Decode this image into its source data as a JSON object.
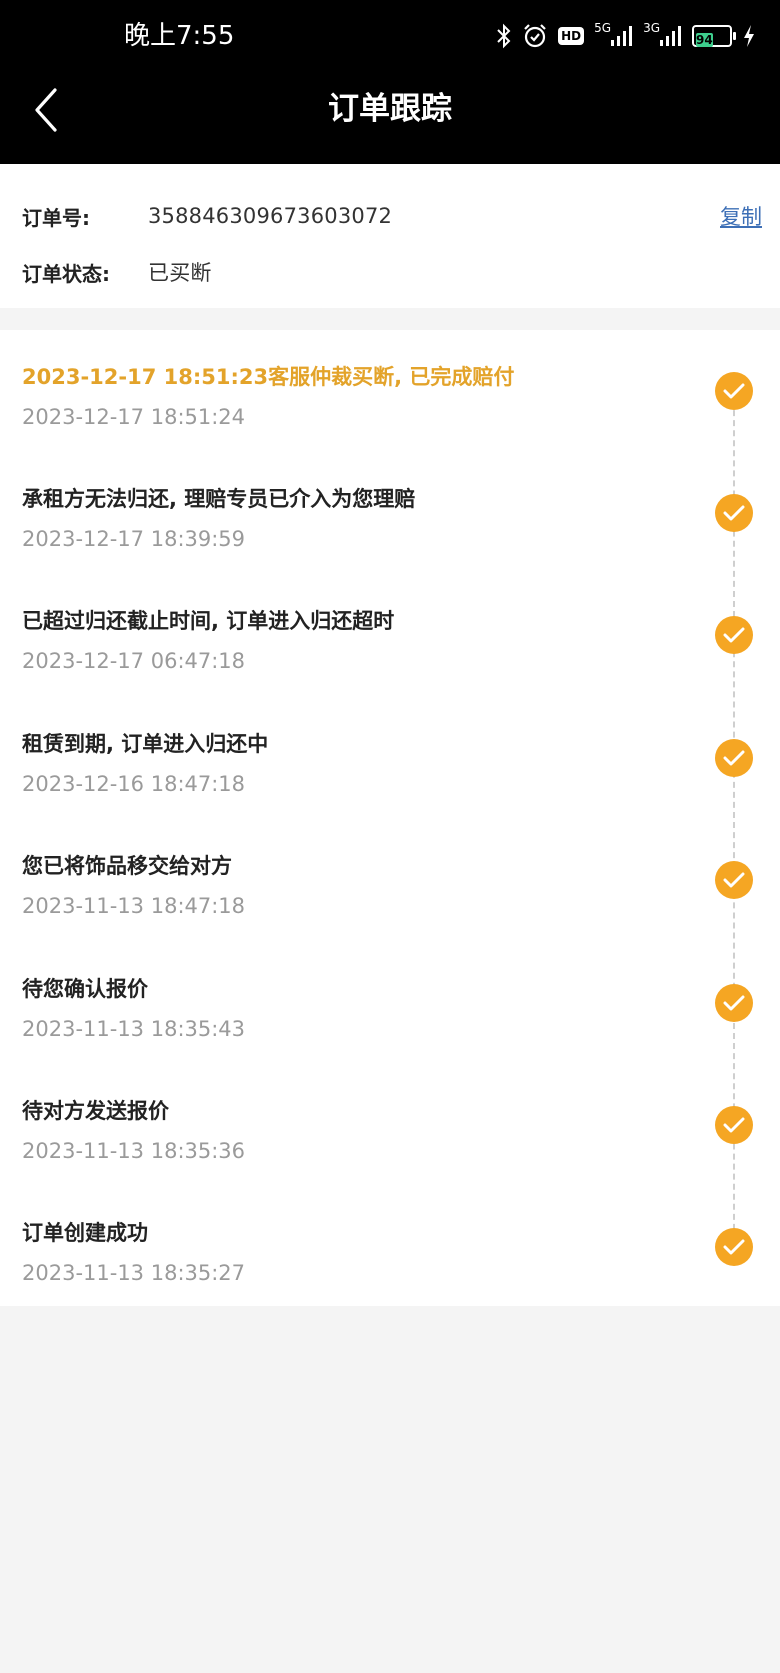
{
  "status_bar": {
    "time": "晚上7:55",
    "hd": "HD",
    "net1": "5G",
    "net2": "3G",
    "battery": "94"
  },
  "header": {
    "title": "订单跟踪"
  },
  "order": {
    "number_label": "订单号:",
    "number": "358846309673603072",
    "copy_label": "复制",
    "status_label": "订单状态:",
    "status": "已买断"
  },
  "timeline": [
    {
      "title": "2023-12-17 18:51:23客服仲裁买断, 已完成赔付",
      "time": "2023-12-17 18:51:24"
    },
    {
      "title": "承租方无法归还, 理赔专员已介入为您理赔",
      "time": "2023-12-17 18:39:59"
    },
    {
      "title": "已超过归还截止时间, 订单进入归还超时",
      "time": "2023-12-17 06:47:18"
    },
    {
      "title": "租赁到期, 订单进入归还中",
      "time": "2023-12-16 18:47:18"
    },
    {
      "title": "您已将饰品移交给对方",
      "time": "2023-11-13 18:47:18"
    },
    {
      "title": "待您确认报价",
      "time": "2023-11-13 18:35:43"
    },
    {
      "title": "待对方发送报价",
      "time": "2023-11-13 18:35:36"
    },
    {
      "title": "订单创建成功",
      "time": "2023-11-13 18:35:27"
    }
  ],
  "colors": {
    "accent": "#f5a623",
    "highlight_text": "#e3a32a",
    "link": "#3d6fb6"
  }
}
